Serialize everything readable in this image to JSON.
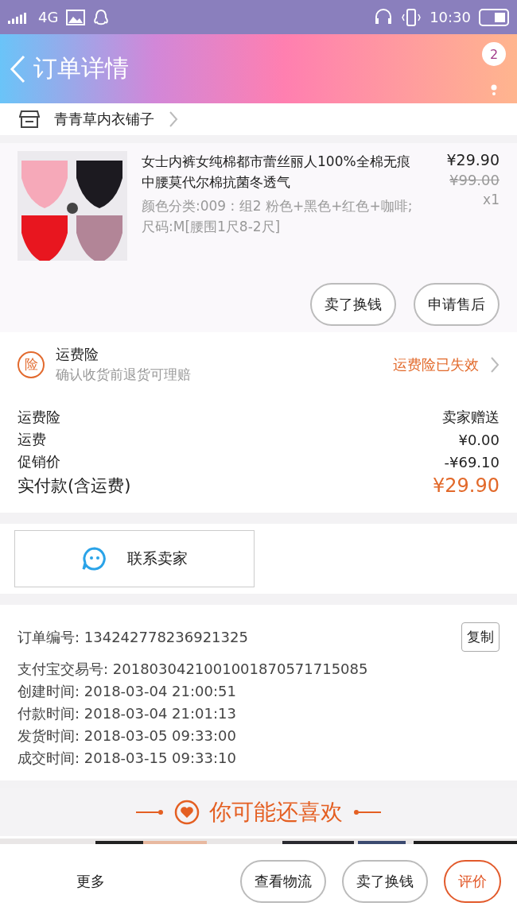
{
  "status_bar": {
    "network": "4G",
    "time": "10:30"
  },
  "header": {
    "title": "订单详情",
    "badge": "2"
  },
  "shop": {
    "name": "青青草内衣铺子"
  },
  "product": {
    "title": "女士内裤女纯棉都市蕾丝丽人100%全棉无痕中腰莫代尔棉抗菌冬透气",
    "spec": "颜色分类:009 : 组2 粉色+黑色+红色+咖啡;尺码:M[腰围1尺8-2尺]",
    "price": "¥29.90",
    "original_price": "¥99.00",
    "quantity": "x1",
    "actions": [
      "卖了换钱",
      "申请售后"
    ]
  },
  "insurance": {
    "icon_text": "险",
    "title": "运费险",
    "subtitle": "确认收货前退货可理赔",
    "status": "运费险已失效"
  },
  "costs": [
    {
      "label": "运费险",
      "value": "卖家赠送",
      "kind": "normal"
    },
    {
      "label": "运费",
      "value": "¥0.00",
      "kind": "normal"
    },
    {
      "label": "促销价",
      "value": "-¥69.10",
      "kind": "normal"
    },
    {
      "label": "实付款(含运费)",
      "value": "¥29.90",
      "kind": "total"
    }
  ],
  "contact_button": "联系卖家",
  "order_info": {
    "copy_button": "复制",
    "lines": [
      "订单编号: 134242778236921325",
      "支付宝交易号: 2018030421001001870571715085",
      "创建时间: 2018-03-04 21:00:51",
      "付款时间: 2018-03-04 21:01:13",
      "发货时间: 2018-03-05 09:33:00",
      "成交时间: 2018-03-15 09:33:10"
    ]
  },
  "recommend": {
    "title": "你可能还喜欢"
  },
  "bottom_bar": {
    "more": "更多",
    "buttons": [
      {
        "label": "查看物流",
        "highlighted": false
      },
      {
        "label": "卖了换钱",
        "highlighted": false
      },
      {
        "label": "评价",
        "highlighted": true
      }
    ]
  }
}
